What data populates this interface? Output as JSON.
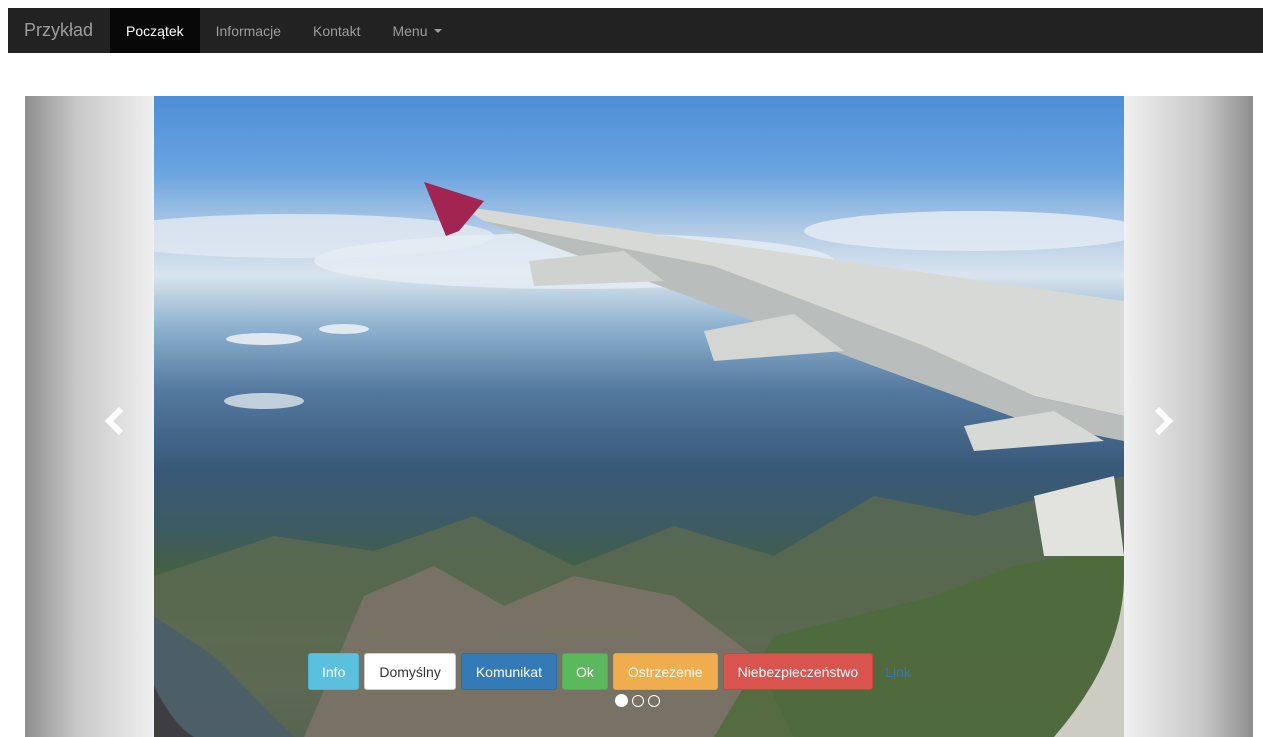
{
  "navbar": {
    "brand": "Przykład",
    "items": [
      {
        "label": "Początek",
        "active": true
      },
      {
        "label": "Informacje"
      },
      {
        "label": "Kontakt"
      },
      {
        "label": "Menu"
      }
    ]
  },
  "carousel": {
    "prev_icon": "chevron-left-icon",
    "next_icon": "chevron-right-icon",
    "slide_description": "airplane-wing-over-mountains-photo",
    "buttons": {
      "info": "Info",
      "default": "Domyślny",
      "primary": "Komunikat",
      "success": "Ok",
      "warning": "Ostrzeżenie",
      "danger": "Niebezpieczeństwo",
      "link": "Link"
    },
    "indicators": [
      true,
      false,
      false
    ]
  },
  "colors": {
    "navbar_bg": "#222222",
    "navbar_active_bg": "#080808",
    "info": "#5bc0de",
    "primary": "#337ab7",
    "success": "#5cb85c",
    "warning": "#f0ad4e",
    "danger": "#d9534f"
  }
}
